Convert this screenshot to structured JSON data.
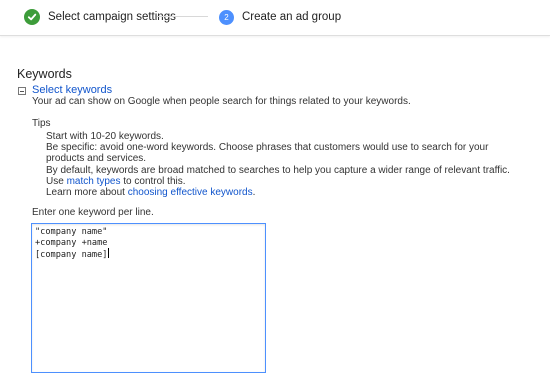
{
  "steps": [
    {
      "label": "Select campaign settings",
      "status": "completed",
      "icon": "check-icon"
    },
    {
      "label": "Create an ad group",
      "number": "2",
      "status": "current"
    }
  ],
  "keywords_section": {
    "title": "Keywords",
    "toggle_icon": "collapse-icon",
    "select_link": "Select keywords",
    "description": "Your ad can show on Google when people search for things related to your keywords.",
    "tips_label": "Tips",
    "tips": {
      "line1": "Start with 10-20 keywords.",
      "line2": "Be specific: avoid one-word keywords. Choose phrases that customers would use to search for your",
      "line3": "products and services.",
      "line4": "By default, keywords are broad matched to searches to help you capture a wider range of relevant traffic.",
      "line5_pre": "Use ",
      "line5_link": "match types",
      "line5_post": " to control this.",
      "line6_pre": "Learn more about ",
      "line6_link": "choosing effective keywords",
      "line6_post": "."
    },
    "input_label": "Enter one keyword per line.",
    "keywords": [
      "\"company name\"",
      "+company +name",
      "[company name]"
    ]
  },
  "colors": {
    "link": "#1155cc",
    "check_green": "#3d9c3a",
    "step_blue": "#4d90fe"
  }
}
